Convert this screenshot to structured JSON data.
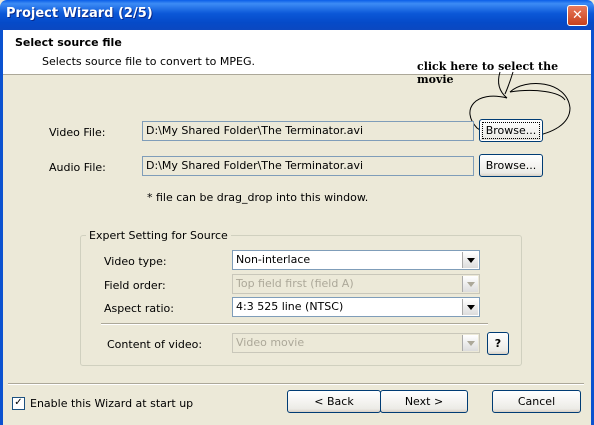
{
  "window": {
    "title": "Project Wizard (2/5)",
    "close_glyph": "✕"
  },
  "header": {
    "title": "Select source file",
    "subtitle": "Selects source file to convert to MPEG."
  },
  "annotation": "click here to select the movie",
  "source": {
    "video_label": "Video File:",
    "video_value": "D:\\My Shared Folder\\The Terminator.avi",
    "audio_label": "Audio File:",
    "audio_value": "D:\\My Shared Folder\\The Terminator.avi",
    "browse_label": "Browse...",
    "hint": "* file can be drag_drop into this window."
  },
  "expert": {
    "legend": "Expert Setting for Source",
    "video_type_label": "Video type:",
    "video_type_value": "Non-interlace",
    "field_order_label": "Field order:",
    "field_order_value": "Top field first (field A)",
    "aspect_label": "Aspect ratio:",
    "aspect_value": "4:3 525 line (NTSC)",
    "content_label": "Content of video:",
    "content_value": "Video movie",
    "help_label": "?"
  },
  "footer": {
    "checkbox_label": "Enable this Wizard at start up",
    "checkbox_checked": true,
    "back_label": "< Back",
    "next_label": "Next >",
    "cancel_label": "Cancel"
  }
}
